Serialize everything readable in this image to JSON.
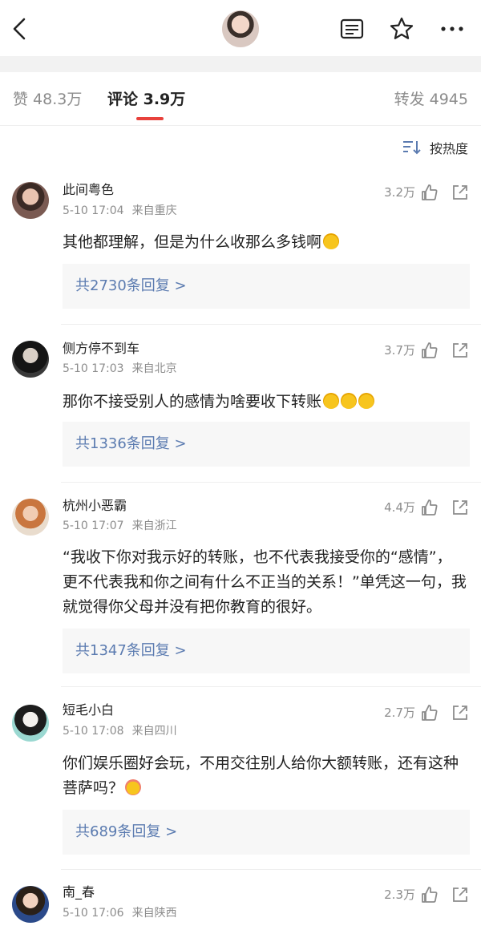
{
  "header": {
    "back_icon": "chevron-left-icon",
    "avatar": "author-avatar",
    "icons": [
      "reader-icon",
      "star-icon",
      "more-icon"
    ]
  },
  "stats": {
    "likes_label": "赞 48.3万",
    "comments_label": "评论 3.9万",
    "reposts_label": "转发 4945",
    "active_color": "#e8413c"
  },
  "sort": {
    "label": "按热度",
    "icon": "sort-icon"
  },
  "comments": [
    {
      "name": "此间粤色",
      "date": "5-10 17:04",
      "location": "来自重庆",
      "likes": "3.2万",
      "text": "其他都理解，但是为什么收那么多钱啊",
      "emoji": "laugh-cry-emoji",
      "replies": "共2730条回复 >"
    },
    {
      "name": "侧方停不到车",
      "date": "5-10 17:03",
      "location": "来自北京",
      "likes": "3.7万",
      "text": "那你不接受别人的感情为啥要收下转账",
      "emoji": "sweat-emoji",
      "replies": "共1336条回复 >"
    },
    {
      "name": "杭州小恶霸",
      "date": "5-10 17:07",
      "location": "来自浙江",
      "likes": "4.4万",
      "text": "“我收下你对我示好的转账，也不代表我接受你的“感情”，更不代表我和你之间有什么不正当的关系！”单凭这一句，我就觉得你父母并没有把你教育的很好。",
      "replies": "共1347条回复 >"
    },
    {
      "name": "短毛小白",
      "date": "5-10 17:08",
      "location": "来自四川",
      "likes": "2.7万",
      "text": "你们娱乐圈好会玩，不用交往别人给你大额转账，还有这种菩萨吗？",
      "emoji": "dizzy-emoji",
      "replies": "共689条回复 >"
    },
    {
      "name": "南_春",
      "date": "5-10 17:06",
      "location": "来自陕西",
      "likes": "2.3万"
    }
  ]
}
